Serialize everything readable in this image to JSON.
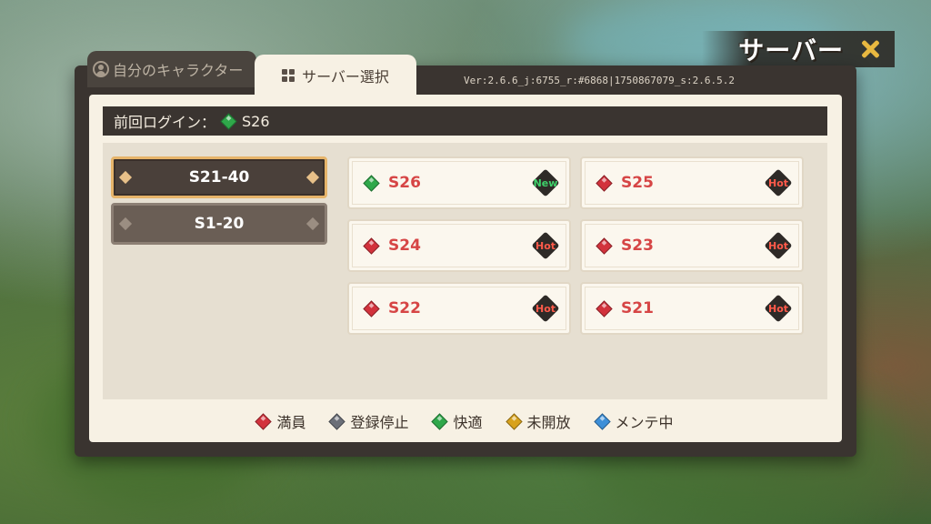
{
  "header": {
    "title": "サーバー"
  },
  "tabs": [
    {
      "label": "自分のキャラクター"
    },
    {
      "label": "サーバー選択"
    }
  ],
  "version": "Ver:2.6.6_j:6755_r:#6868|1750867079_s:2.6.5.2",
  "last_login": {
    "label": "前回ログイン：",
    "server": "S26",
    "status_color": "#2fa84a"
  },
  "ranges": [
    {
      "label": "S21-40",
      "selected": true
    },
    {
      "label": "S1-20",
      "selected": false
    }
  ],
  "servers": [
    {
      "name": "S26",
      "status": "green",
      "badge": "New"
    },
    {
      "name": "S25",
      "status": "red",
      "badge": "Hot"
    },
    {
      "name": "S24",
      "status": "red",
      "badge": "Hot"
    },
    {
      "name": "S23",
      "status": "red",
      "badge": "Hot"
    },
    {
      "name": "S22",
      "status": "red",
      "badge": "Hot"
    },
    {
      "name": "S21",
      "status": "red",
      "badge": "Hot"
    }
  ],
  "legend": [
    {
      "label": "満員",
      "color": "red"
    },
    {
      "label": "登録停止",
      "color": "gray"
    },
    {
      "label": "快適",
      "color": "green"
    },
    {
      "label": "未開放",
      "color": "yellow"
    },
    {
      "label": "メンテ中",
      "color": "blue"
    }
  ]
}
